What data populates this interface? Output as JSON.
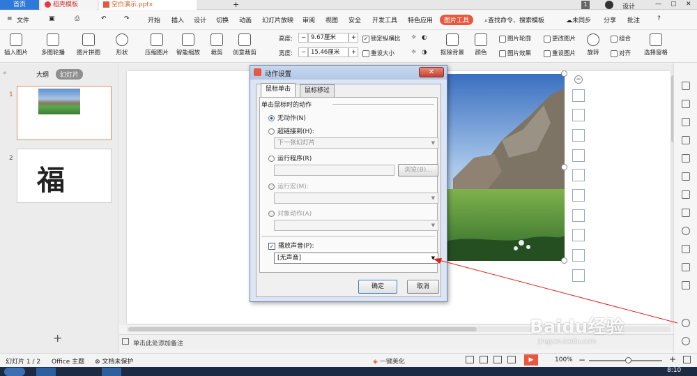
{
  "titlebar": {
    "home_tab": "首页",
    "template_tab": "稻壳模板",
    "file_tab": "空白演示.pptx",
    "plus": "+",
    "badge": "1",
    "design_label": "设计"
  },
  "menubar": {
    "file_menu": "文件",
    "items": [
      "开始",
      "插入",
      "设计",
      "切换",
      "动画",
      "幻灯片放映",
      "审阅",
      "视图",
      "安全",
      "开发工具",
      "特色应用"
    ],
    "active": "图片工具",
    "search": "查找命令、搜索模板",
    "sync": "未同步",
    "share": "分享",
    "comment": "批注",
    "help": "?"
  },
  "ribbon": {
    "insert_pic": "插入图片",
    "multi_pic": "多图轮播",
    "pic_collage": "图片拼图",
    "shape": "形状",
    "compress": "压缩图片",
    "smart_scale": "智能缩放",
    "crop": "裁剪",
    "creative_crop": "创意裁剪",
    "height_label": "高度:",
    "height_value": "9.67厘米",
    "width_label": "宽度:",
    "width_value": "15.46厘米",
    "lock_ratio": "锁定纵横比",
    "reset_size": "重设大小",
    "remove_bg": "抠除背景",
    "color": "颜色",
    "pic_outline": "图片轮廓",
    "pic_effect": "图片效果",
    "change_pic": "更改图片",
    "reset_pic": "重设图片",
    "rotate": "旋转",
    "group": "组合",
    "align": "对齐",
    "select_pane": "选择窗格"
  },
  "left_panel": {
    "outline_tab": "大纲",
    "slides_tab": "幻灯片",
    "slide1_num": "1",
    "slide2_num": "2",
    "slide2_char": "福",
    "add": "+"
  },
  "dialog": {
    "title": "动作设置",
    "close": "✕",
    "tab_click": "鼠标单击",
    "tab_hover": "鼠标移过",
    "section": "单击鼠标时的动作",
    "no_action": "无动作(N)",
    "hyperlink": "超链接到(H):",
    "hyperlink_value": "下一张幻灯片",
    "run_program": "运行程序(R)",
    "browse": "浏览(B)...",
    "run_macro": "运行宏(M):",
    "object_action": "对象动作(A)",
    "play_sound": "播放声音(P):",
    "sound_value": "[无声音]",
    "ok": "确定",
    "cancel": "取消"
  },
  "notes": {
    "placeholder": "单击此处添加备注"
  },
  "status": {
    "slide_count": "幻灯片 1 / 2",
    "theme": "Office 主题",
    "protection": "文档未保护",
    "beautify": "一键美化",
    "zoom": "100%",
    "minus": "−",
    "plus": "+"
  },
  "taskbar": {
    "time": "8:10"
  },
  "watermark": {
    "brand": "Baidu经验",
    "url": "jingyan.baidu.com"
  },
  "colors": {
    "accent": "#e9573f",
    "blue": "#2f7ad8",
    "arrow": "#e02020"
  }
}
